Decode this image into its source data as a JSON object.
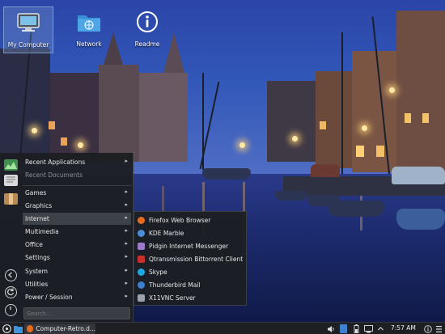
{
  "desktop": {
    "icons": [
      {
        "label": "My Computer",
        "icon": "computer-icon"
      },
      {
        "label": "Network",
        "icon": "network-folder-icon"
      },
      {
        "label": "Readme",
        "icon": "info-icon"
      }
    ]
  },
  "menu": {
    "favorites": [
      {
        "icon": "recent-applications-icon",
        "color": "#3f8f4e"
      },
      {
        "icon": "recent-documents-icon",
        "color": "#d9d9d9"
      },
      {
        "icon": "games-box-icon",
        "color": "#b98a55"
      }
    ],
    "categories": [
      {
        "label": "Recent Applications",
        "has_submenu": true,
        "dim": false
      },
      {
        "label": "Recent Documents",
        "has_submenu": false,
        "dim": true
      },
      {
        "label": "Games",
        "has_submenu": true,
        "dim": false
      },
      {
        "label": "Graphics",
        "has_submenu": true,
        "dim": false
      },
      {
        "label": "Internet",
        "has_submenu": true,
        "dim": false,
        "active": true
      },
      {
        "label": "Multimedia",
        "has_submenu": true,
        "dim": false
      },
      {
        "label": "Office",
        "has_submenu": true,
        "dim": false
      },
      {
        "label": "Settings",
        "has_submenu": true,
        "dim": false
      },
      {
        "label": "System",
        "has_submenu": true,
        "dim": false
      },
      {
        "label": "Utilities",
        "has_submenu": true,
        "dim": false
      },
      {
        "label": "Power / Session",
        "has_submenu": true,
        "dim": false
      }
    ],
    "arrow_glyph": "▸",
    "search_placeholder": "Search...",
    "side_actions": [
      "back-icon",
      "refresh-icon",
      "power-icon"
    ],
    "internet_submenu": [
      {
        "label": "Firefox Web Browser",
        "icon": "firefox-icon",
        "color": "#e66b1f"
      },
      {
        "label": "KDE Marble",
        "icon": "marble-globe-icon",
        "color": "#4b8ed8"
      },
      {
        "label": "Pidgin Internet Messenger",
        "icon": "pidgin-icon",
        "color": "#9b7bc9"
      },
      {
        "label": "Qtransmission Bittorrent Client",
        "icon": "transmission-icon",
        "color": "#c9302c"
      },
      {
        "label": "Skype",
        "icon": "skype-icon",
        "color": "#1ea7e0"
      },
      {
        "label": "Thunderbird Mail",
        "icon": "thunderbird-icon",
        "color": "#3f7fd0"
      },
      {
        "label": "X11VNC Server",
        "icon": "monitor-icon",
        "color": "#9aa3ad"
      }
    ]
  },
  "taskbar": {
    "task_label": "Computer-Retro.d...",
    "clock": "7:57 AM",
    "tray_icons": [
      "volume-icon",
      "bluetooth-icon",
      "battery-icon",
      "network-icon",
      "arrow-up-icon",
      "info-icon"
    ]
  }
}
